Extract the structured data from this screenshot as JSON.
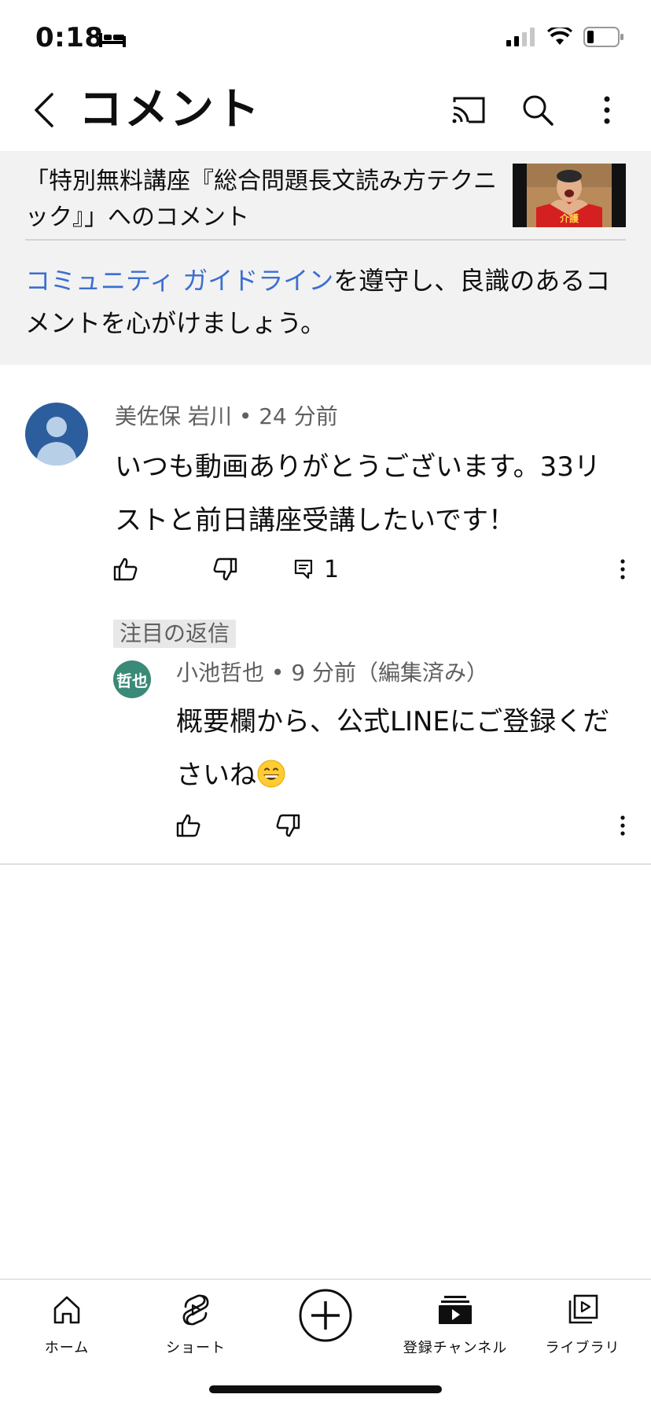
{
  "status_bar": {
    "time": "0:18"
  },
  "app_bar": {
    "title": "コメント"
  },
  "video_header": {
    "title": "「特別無料講座『総合問題長文読み方テクニック』」へのコメント",
    "thumbnail_text": "介護"
  },
  "guidelines": {
    "link_text": "コミュニティ ガイドライン",
    "rest_text": "を遵守し、良識のあるコメントを心がけましょう。"
  },
  "comment": {
    "author": "美佐保 岩川",
    "separator": "•",
    "time": "24 分前",
    "text": "いつも動画ありがとうございます。33リストと前日講座受講したいです！",
    "reply_count": "1"
  },
  "featured_reply": {
    "badge": "注目の返信",
    "avatar_text": "哲也",
    "author": "小池哲也",
    "separator": "•",
    "time": "9 分前（編集済み）",
    "text": "概要欄から、公式LINEにご登録くださいね"
  },
  "bottom_nav": {
    "home": "ホーム",
    "shorts": "ショート",
    "subscriptions": "登録チャンネル",
    "library": "ライブラリ"
  },
  "colors": {
    "link": "#3b6fd1",
    "header_bg": "#f2f2f2",
    "avatar_main": "#2c5d9c",
    "avatar_reply": "#3a8a78"
  }
}
